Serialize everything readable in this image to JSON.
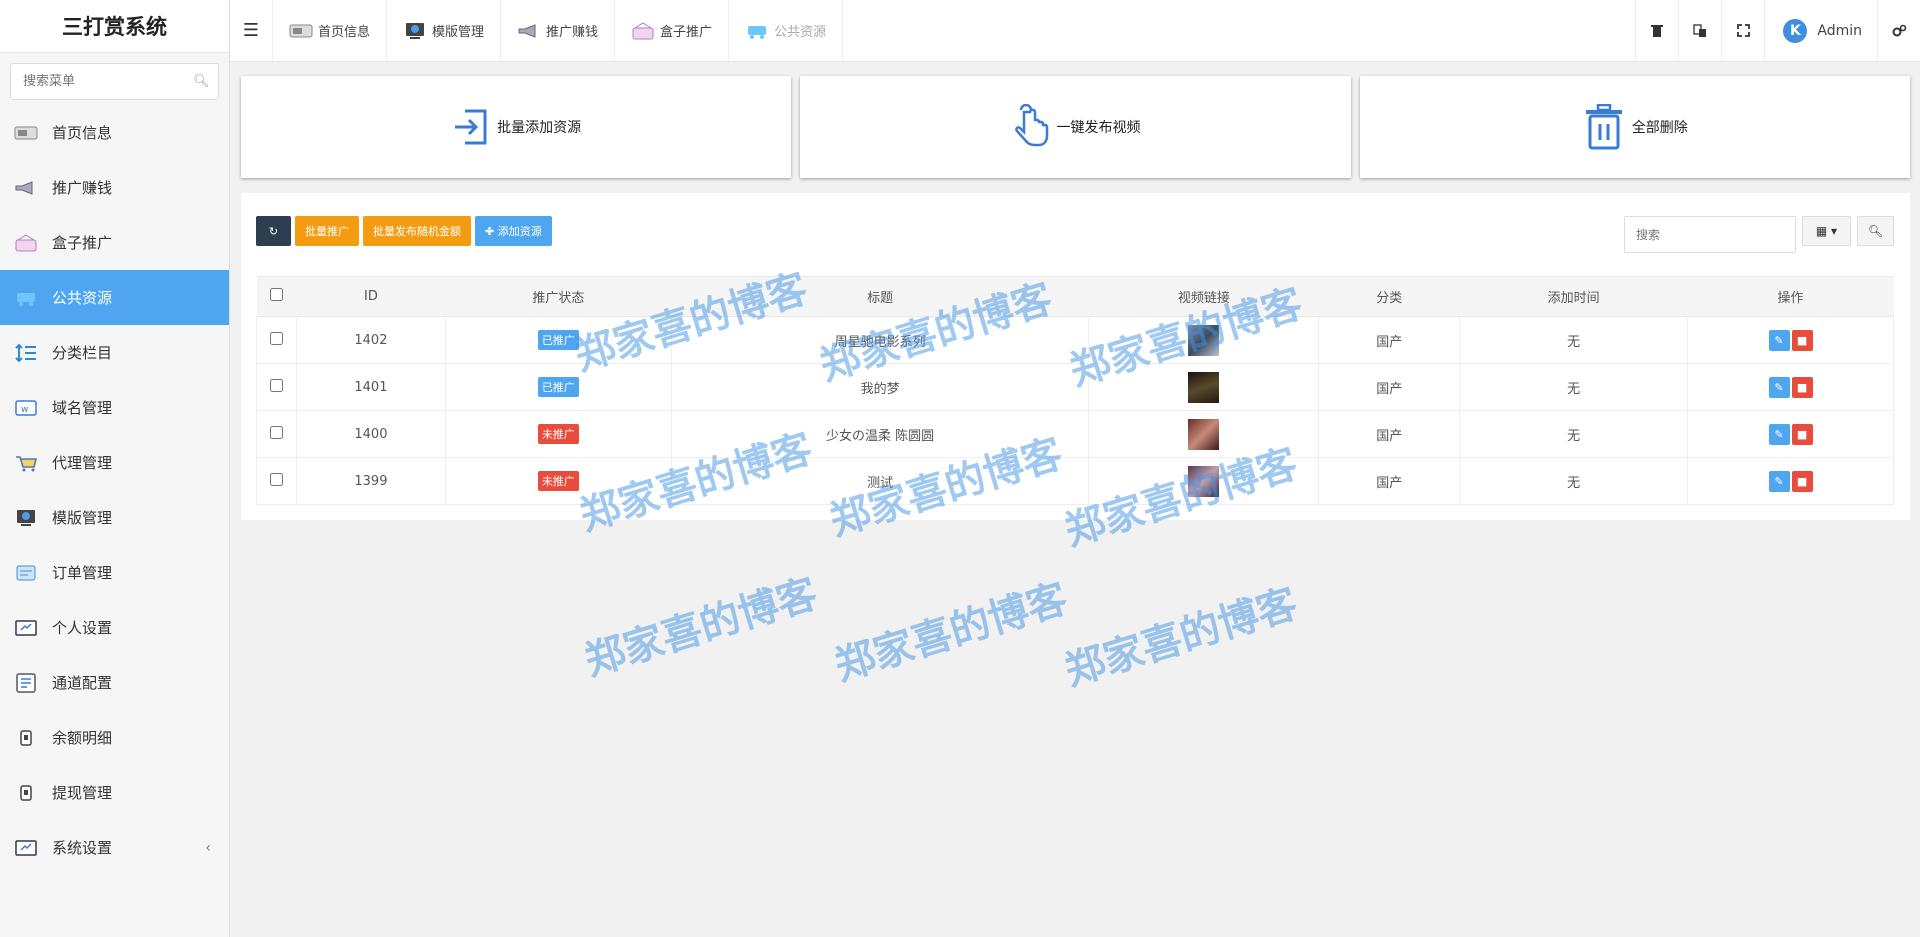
{
  "app": {
    "title": "三打赏系统"
  },
  "sidebar": {
    "search_placeholder": "搜索菜单",
    "items": [
      {
        "label": "首页信息"
      },
      {
        "label": "推广赚钱"
      },
      {
        "label": "盒子推广"
      },
      {
        "label": "公共资源"
      },
      {
        "label": "分类栏目"
      },
      {
        "label": "域名管理"
      },
      {
        "label": "代理管理"
      },
      {
        "label": "模版管理"
      },
      {
        "label": "订单管理"
      },
      {
        "label": "个人设置"
      },
      {
        "label": "通道配置"
      },
      {
        "label": "余额明细"
      },
      {
        "label": "提现管理"
      },
      {
        "label": "系统设置"
      }
    ],
    "active": "公共资源",
    "collapse_glyph": "‹"
  },
  "topbar": {
    "tabs": [
      {
        "label": "首页信息"
      },
      {
        "label": "模版管理"
      },
      {
        "label": "推广赚钱"
      },
      {
        "label": "盒子推广"
      },
      {
        "label": "公共资源"
      }
    ],
    "user": "Admin",
    "avatar_letter": "K"
  },
  "actions": {
    "batch_add": "批量添加资源",
    "publish": "一键发布视频",
    "delete_all": "全部删除"
  },
  "toolbar": {
    "batch_promote": "批量推广",
    "batch_random": "批量发布随机金额",
    "add": "✚ 添加资源",
    "search_placeholder": "搜索",
    "columns_icon": "▦ ▾"
  },
  "table": {
    "headers": [
      "ID",
      "推广状态",
      "标题",
      "视频链接",
      "分类",
      "添加时间",
      "操作"
    ],
    "rows": [
      {
        "id": "1402",
        "status": "已推广",
        "title": "周星驰电影系列",
        "category": "国产",
        "time": "无"
      },
      {
        "id": "1401",
        "status": "已推广",
        "title": "我的梦",
        "category": "国产",
        "time": "无"
      },
      {
        "id": "1400",
        "status": "未推广",
        "title": "少女の温柔 陈圆圆",
        "category": "国产",
        "time": "无"
      },
      {
        "id": "1399",
        "status": "未推广",
        "title": "测试",
        "category": "国产",
        "time": "无"
      }
    ]
  },
  "colors": {
    "accent": "#4fa6f0",
    "promoted": "#4fa6f0",
    "not_promoted": "#e74c3c",
    "orange": "#f39c12",
    "dark": "#2c3e50"
  },
  "watermark": "郑家喜的博客"
}
